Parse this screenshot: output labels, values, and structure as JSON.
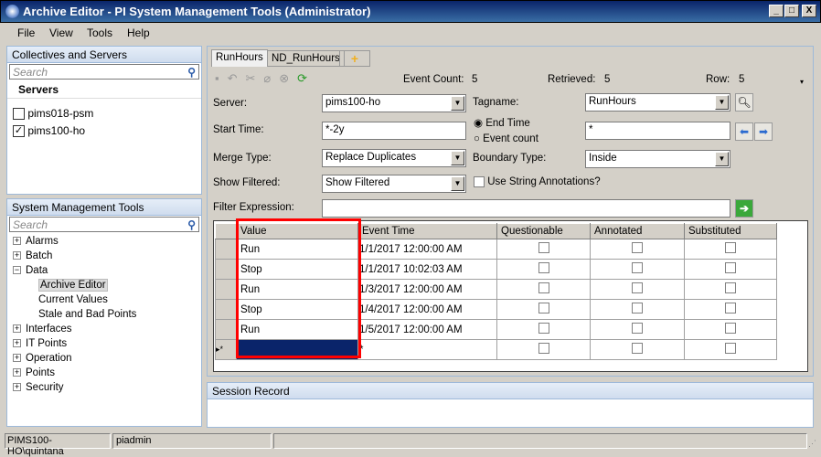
{
  "window": {
    "title": "Archive Editor - PI System Management Tools (Administrator)",
    "controls": [
      "_",
      "□",
      "X"
    ]
  },
  "menu": [
    "File",
    "View",
    "Tools",
    "Help"
  ],
  "collectives": {
    "title": "Collectives and Servers",
    "search_placeholder": "Search",
    "heading": "Servers",
    "servers": [
      {
        "name": "pims018-psm",
        "checked": false
      },
      {
        "name": "pims100-ho",
        "checked": true
      }
    ]
  },
  "smt": {
    "title": "System Management Tools",
    "search_placeholder": "Search",
    "tree": [
      {
        "label": "Alarms",
        "level": 0,
        "expander": "+"
      },
      {
        "label": "Batch",
        "level": 0,
        "expander": "+"
      },
      {
        "label": "Data",
        "level": 0,
        "expander": "-"
      },
      {
        "label": "Archive Editor",
        "level": 1,
        "selected": true
      },
      {
        "label": "Current Values",
        "level": 1
      },
      {
        "label": "Stale and Bad Points",
        "level": 1
      },
      {
        "label": "Interfaces",
        "level": 0,
        "expander": "+"
      },
      {
        "label": "IT Points",
        "level": 0,
        "expander": "+"
      },
      {
        "label": "Operation",
        "level": 0,
        "expander": "+"
      },
      {
        "label": "Points",
        "level": 0,
        "expander": "+"
      },
      {
        "label": "Security",
        "level": 0,
        "expander": "+"
      }
    ]
  },
  "tabs": [
    {
      "label": "RunHours",
      "active": true
    },
    {
      "label": "ND_RunHours"
    },
    {
      "label": "+"
    }
  ],
  "toolbar": {
    "event_count_label": "Event Count:",
    "event_count": "5",
    "retrieved_label": "Retrieved:",
    "retrieved": "5",
    "row_label": "Row:",
    "row": "5"
  },
  "form": {
    "server_label": "Server:",
    "server": "pims100-ho",
    "tagname_label": "Tagname:",
    "tagname": "RunHours",
    "start_label": "Start Time:",
    "start": "*-2y",
    "end_time_label": "End Time",
    "event_count_label": "Event count",
    "end": "*",
    "merge_label": "Merge Type:",
    "merge": "Replace Duplicates",
    "boundary_label": "Boundary Type:",
    "boundary": "Inside",
    "show_filtered_label": "Show Filtered:",
    "show_filtered": "Show Filtered",
    "string_ann_label": "Use String Annotations?",
    "filter_label": "Filter Expression:",
    "filter": ""
  },
  "grid": {
    "columns": [
      "Value",
      "Event Time",
      "Questionable",
      "Annotated",
      "Substituted"
    ],
    "rows": [
      {
        "value": "Run",
        "time": "1/1/2017 12:00:00 AM"
      },
      {
        "value": "Stop",
        "time": "1/1/2017 10:02:03 AM"
      },
      {
        "value": "Run",
        "time": "1/3/2017 12:00:00 AM"
      },
      {
        "value": "Stop",
        "time": "1/4/2017 12:00:00 AM"
      },
      {
        "value": "Run",
        "time": "1/5/2017 12:00:00 AM"
      }
    ],
    "new_row_marker": "▸*",
    "new_row_time": "*"
  },
  "session": {
    "title": "Session Record"
  },
  "status": {
    "connection": "PIMS100-HO\\quintana",
    "user": "piadmin"
  },
  "colors": {
    "highlight": "#ff0000",
    "selected_cell": "#0a246a"
  }
}
